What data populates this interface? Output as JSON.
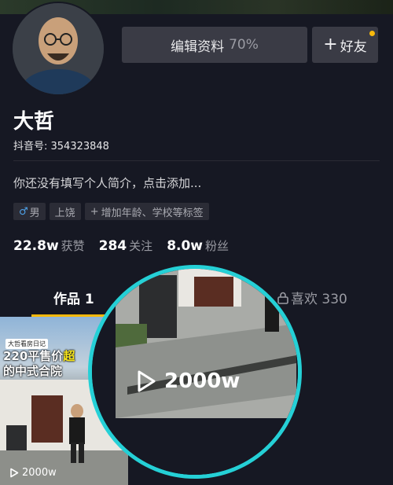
{
  "profile": {
    "name": "大哲",
    "douyin_id": "抖音号: 354323848",
    "bio": "你还没有填写个人简介，点击添加..."
  },
  "actions": {
    "edit_profile": "编辑资料",
    "edit_percent": "70%",
    "add_friend": "好友"
  },
  "tags": {
    "gender": "男",
    "location": "上饶",
    "add": "增加年龄、学校等标签"
  },
  "stats": {
    "likes_num": "22.8w",
    "likes_label": "获赞",
    "following_num": "284",
    "following_label": "关注",
    "followers_num": "8.0w",
    "followers_label": "粉丝"
  },
  "tabs": {
    "works": "作品 1",
    "liked": "喜欢 330"
  },
  "video": {
    "channel_label": "大哲看房日记",
    "title_part1": "220平售价",
    "title_highlight": "超",
    "title_line2": "的中式合院",
    "views": "2000w"
  },
  "magnifier": {
    "views": "2000w"
  },
  "colors": {
    "background": "#161823",
    "accent": "#f8b90c",
    "magnifier_ring": "#25d0d6"
  }
}
